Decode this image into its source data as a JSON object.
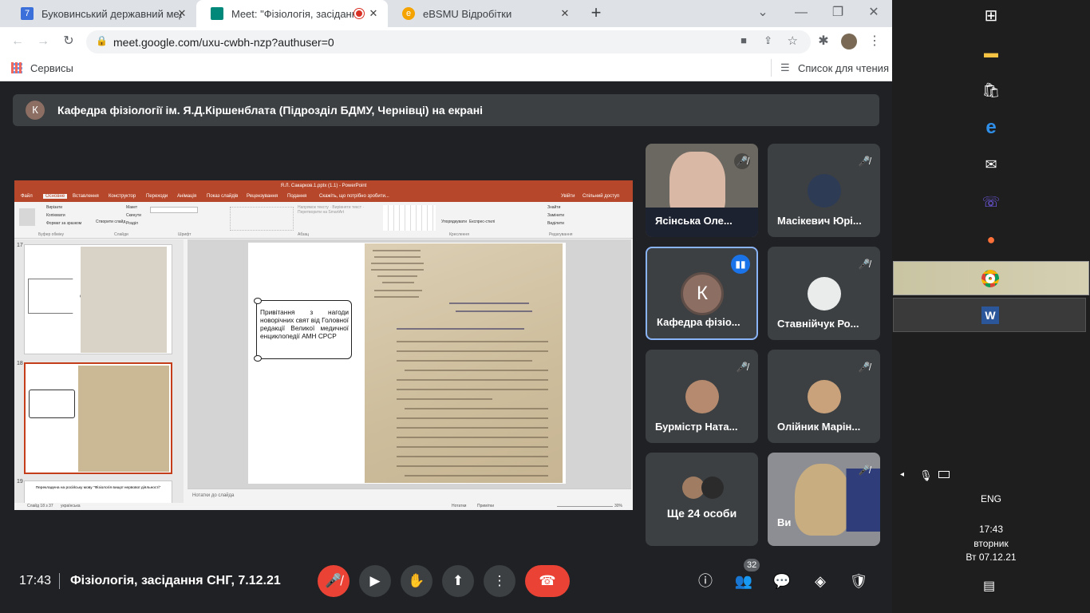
{
  "browser": {
    "tabs": [
      {
        "label": "Буковинський державний меди",
        "favicon_color": "#3b6fd9",
        "favicon_text": "7"
      },
      {
        "label": "Meet: \"Фізіологія, засідання",
        "favicon_color": "#00897b",
        "favicon_text": ""
      },
      {
        "label": "eBSMU Відробітки",
        "favicon_color": "#f4a300",
        "favicon_text": "e"
      }
    ],
    "new_tab": "+",
    "url": "meet.google.com/uxu-cwbh-nzp?authuser=0",
    "bookmarks_label": "Сервисы",
    "reading_list": "Список для чтения"
  },
  "banner": {
    "avatar": "К",
    "text": "Кафедра фізіології ім. Я.Д.Кіршенблата (Підрозділ БДМУ, Чернівці) на екрані"
  },
  "presentation": {
    "title": "Я.Л. Сакарков.1.pptx (1.1) - PowerPoint",
    "menu": [
      "Файл",
      "Основне",
      "Вставлення",
      "Конструктор",
      "Переходи",
      "Анімація",
      "Показ слайдів",
      "Рецензування",
      "Подання",
      "Скажіть, що потрібно зробити..."
    ],
    "ribbon_groups": [
      "Буфер обміну",
      "Слайди",
      "Шрифт",
      "Абзац",
      "Креслення",
      "Редагування"
    ],
    "ribbon_items": [
      "Вирізати",
      "Копіювати",
      "Формат за зразком",
      "Макет",
      "Скинути",
      "Розділ",
      "Вставити",
      "Створити слайд",
      "Знайти",
      "Замінити",
      "Виділити",
      "Упорядкувати",
      "Експрес-стилі"
    ],
    "share": "Спільний доступ",
    "user": "Увійти",
    "thumb_numbers": [
      "17",
      "18",
      "19"
    ],
    "thumb19_caption": "Перекладена на російську мову \"Фізіологія вищої нервової діяльності\"",
    "callout_text": "Привітання з нагоди новорічних свят від Головної редакції Великої медичної енциклопедії АМН СРСР",
    "notes": "Нотатки до слайда",
    "status_slide": "Слайд 18 з 37",
    "status_lang": "українська",
    "status_notes": "Нотатки",
    "status_comments": "Примітки",
    "zoom": "30%"
  },
  "participants": [
    {
      "name": "Ясінська Оле...",
      "muted": true,
      "kind": "video"
    },
    {
      "name": "Масікевич Юрі...",
      "muted": true,
      "kind": "photo"
    },
    {
      "name": "Кафедра фізіо...",
      "muted": false,
      "kind": "avatar",
      "initial": "К",
      "speaking": true
    },
    {
      "name": "Ставнійчук Ро...",
      "muted": true,
      "kind": "photo"
    },
    {
      "name": "Бурмістр Ната...",
      "muted": true,
      "kind": "photo"
    },
    {
      "name": "Олійник Марін...",
      "muted": true,
      "kind": "photo"
    },
    {
      "name": "Ще 24 особи",
      "muted": false,
      "kind": "group"
    },
    {
      "name": "Ви",
      "muted": true,
      "kind": "video"
    }
  ],
  "bottom": {
    "time": "17:43",
    "meeting_name": "Фізіологія, засідання СНГ, 7.12.21",
    "participants_count": "32"
  },
  "system": {
    "lang": "ENG",
    "time": "17:43",
    "weekday": "вторник",
    "date": "Вт 07.12.21"
  },
  "colors": {
    "end_call": "#ea4335",
    "mic_off": "#ea4335",
    "accent": "#8ab4f8",
    "ppt": "#b7472a"
  }
}
